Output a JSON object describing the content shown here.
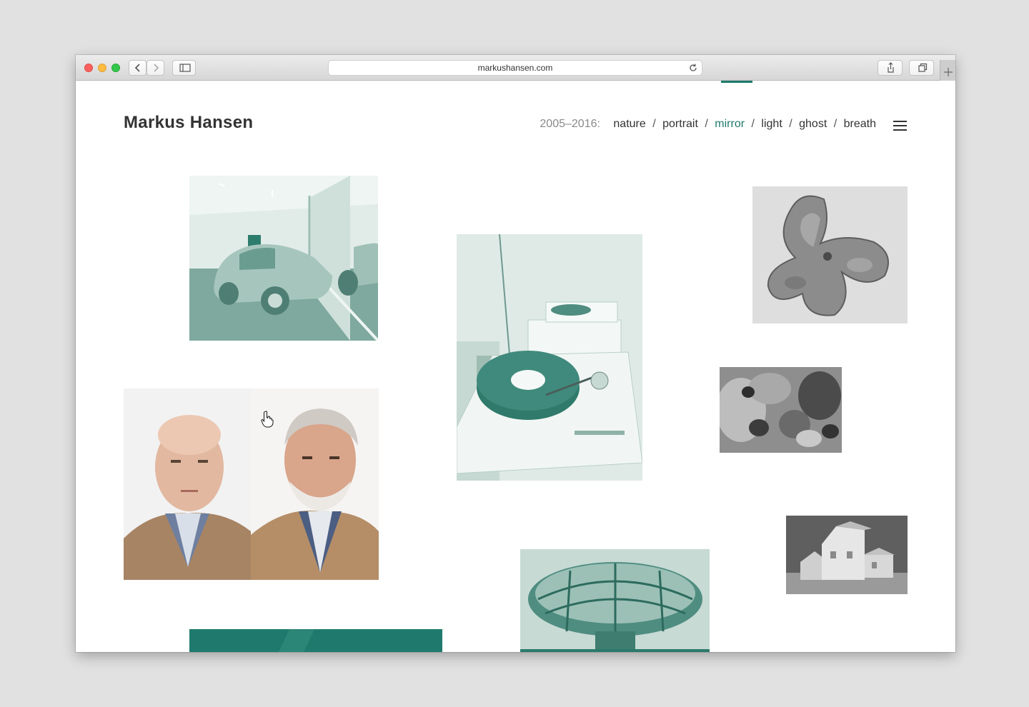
{
  "browser": {
    "url": "markushansen.com"
  },
  "site": {
    "title": "Markus Hansen"
  },
  "nav": {
    "years": "2005–2016:",
    "items": [
      {
        "label": "nature",
        "active": false
      },
      {
        "label": "portrait",
        "active": false
      },
      {
        "label": "mirror",
        "active": true
      },
      {
        "label": "light",
        "active": false
      },
      {
        "label": "ghost",
        "active": false
      },
      {
        "label": "breath",
        "active": false
      }
    ],
    "separator": "/"
  },
  "colors": {
    "accent": "#1f7a6d",
    "duotone_light": "#c9dcd6",
    "duotone_dark": "#3f8a7c"
  },
  "icons": {
    "menu": "hamburger-menu-icon",
    "reload": "reload-icon",
    "share": "share-icon",
    "tabs": "tabs-icon",
    "sidebar": "sidebar-icon",
    "back": "chevron-left-icon",
    "forward": "chevron-right-icon",
    "new_tab": "plus-icon",
    "pointer": "hand-pointer-icon"
  }
}
